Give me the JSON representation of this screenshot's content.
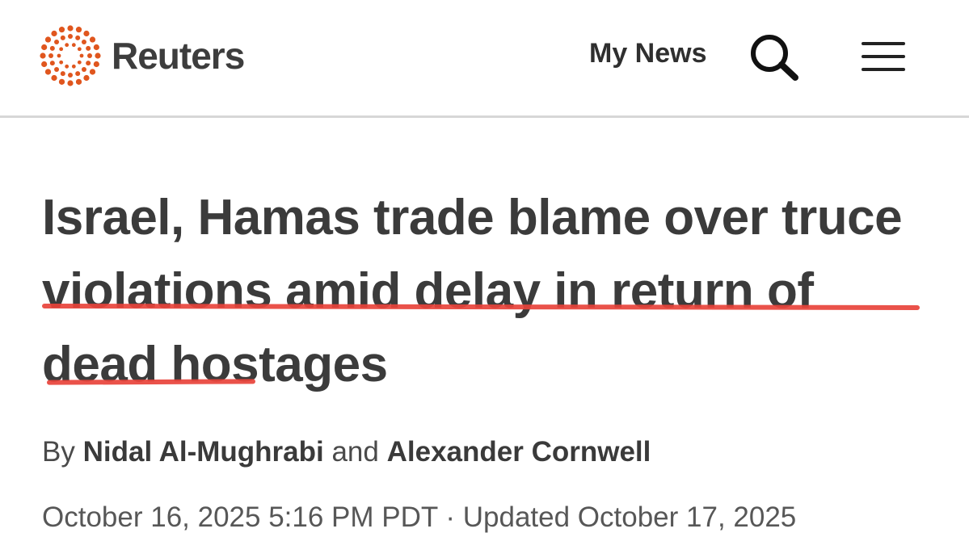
{
  "header": {
    "brand": "Reuters",
    "my_news_label": "My News",
    "icons": {
      "logo": "reuters-dot-logo-icon",
      "search": "search-icon",
      "menu": "hamburger-menu-icon"
    },
    "brand_color": "#e0561e"
  },
  "article": {
    "headline": "Israel, Hamas trade blame over truce violations amid delay in return of dead hostages",
    "byline": {
      "prefix": "By",
      "author1": "Nidal Al-Mughrabi",
      "conjunction": "and",
      "author2": "Alexander Cornwell"
    },
    "published": "October 16, 2025 5:16 PM PDT",
    "separator": "·",
    "updated": "Updated October 17, 2025",
    "annotation_color": "#e8433b"
  }
}
